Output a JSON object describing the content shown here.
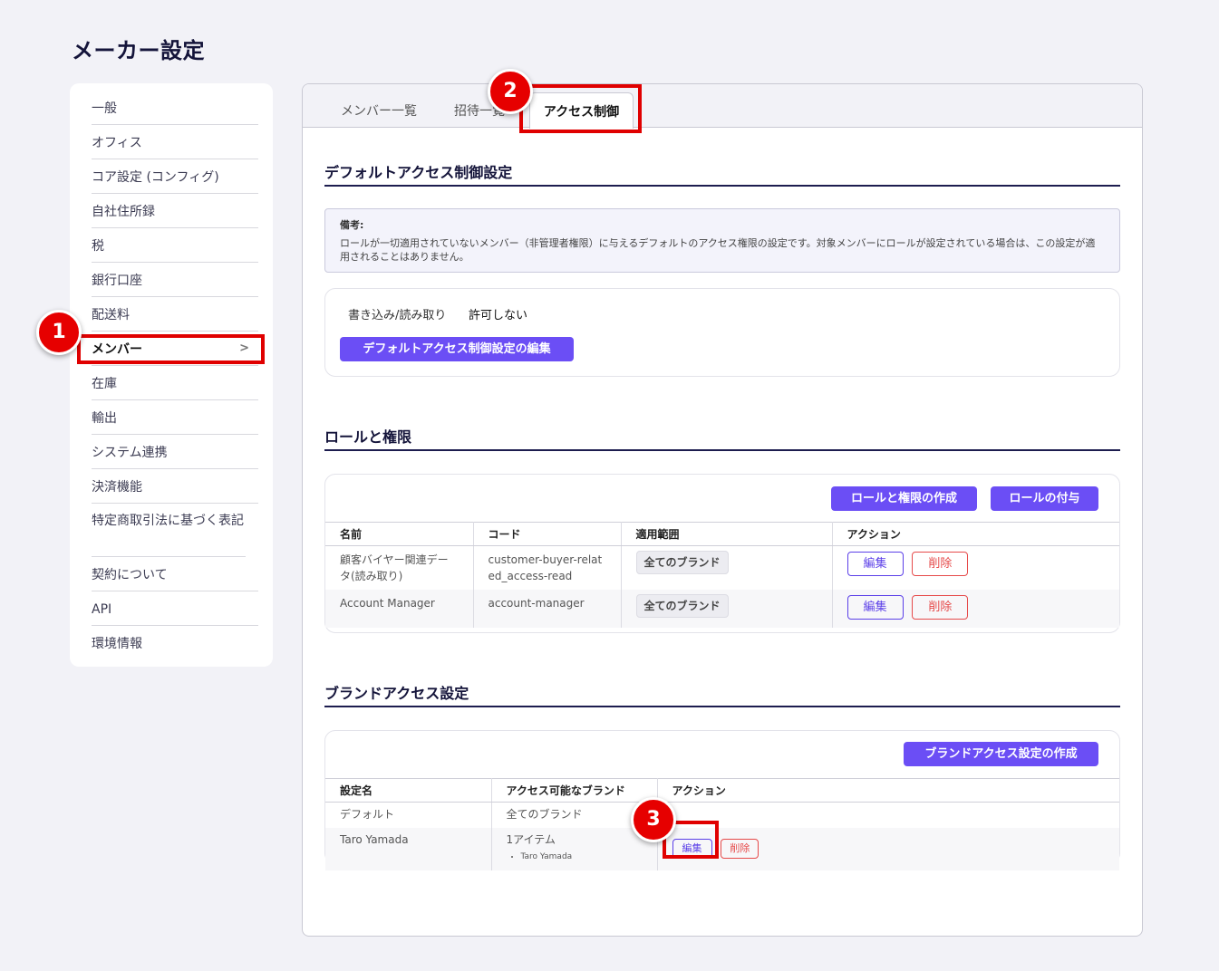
{
  "page": {
    "title": "メーカー設定"
  },
  "sidebar": {
    "items": [
      {
        "label": "一般"
      },
      {
        "label": "オフィス"
      },
      {
        "label": "コア設定 (コンフィグ)"
      },
      {
        "label": "自社住所録"
      },
      {
        "label": "税"
      },
      {
        "label": "銀行口座"
      },
      {
        "label": "配送料"
      },
      {
        "label": "メンバー",
        "chevron": ">"
      },
      {
        "label": "在庫"
      },
      {
        "label": "輸出"
      },
      {
        "label": "システム連携"
      },
      {
        "label": "決済機能"
      },
      {
        "label": "特定商取引法に基づく表記"
      },
      {
        "label": "契約について"
      },
      {
        "label": "API"
      },
      {
        "label": "環境情報"
      }
    ]
  },
  "tabs": [
    {
      "label": "メンバー一覧"
    },
    {
      "label": "招待一覧"
    },
    {
      "label": "アクセス制御"
    }
  ],
  "default_access": {
    "title": "デフォルトアクセス制御設定",
    "note_title": "備考:",
    "note_body": "ロールが一切適用されていないメンバー（非管理者権限）に与えるデフォルトのアクセス権限の設定です。対象メンバーにロールが設定されている場合は、この設定が適用されることはありません。",
    "permission_label": "書き込み/読み取り",
    "permission_value": "許可しない",
    "edit_button": "デフォルトアクセス制御設定の編集"
  },
  "roles": {
    "title": "ロールと権限",
    "create_button": "ロールと権限の作成",
    "assign_button": "ロールの付与",
    "columns": [
      "名前",
      "コード",
      "適用範囲",
      "アクション"
    ],
    "rows": [
      {
        "name": "顧客バイヤー関連データ(読み取り)",
        "code": "customer-buyer-related_access-read",
        "scope": "全てのブランド"
      },
      {
        "name": "Account Manager",
        "code": "account-manager",
        "scope": "全てのブランド"
      }
    ],
    "edit_label": "編集",
    "delete_label": "削除"
  },
  "brand_access": {
    "title": "ブランドアクセス設定",
    "create_button": "ブランドアクセス設定の作成",
    "columns": [
      "設定名",
      "アクセス可能なブランド",
      "アクション"
    ],
    "rows": [
      {
        "name": "デフォルト",
        "brands": "全てのブランド"
      },
      {
        "name": "Taro Yamada",
        "brands": "1アイテム",
        "sub": "Taro Yamada"
      }
    ],
    "edit_label": "編集",
    "delete_label": "削除"
  },
  "annotations": [
    "1",
    "2",
    "3"
  ],
  "colors": {
    "accent": "#6b4ef5",
    "danger": "#e64a4a",
    "highlight": "#e00000"
  }
}
